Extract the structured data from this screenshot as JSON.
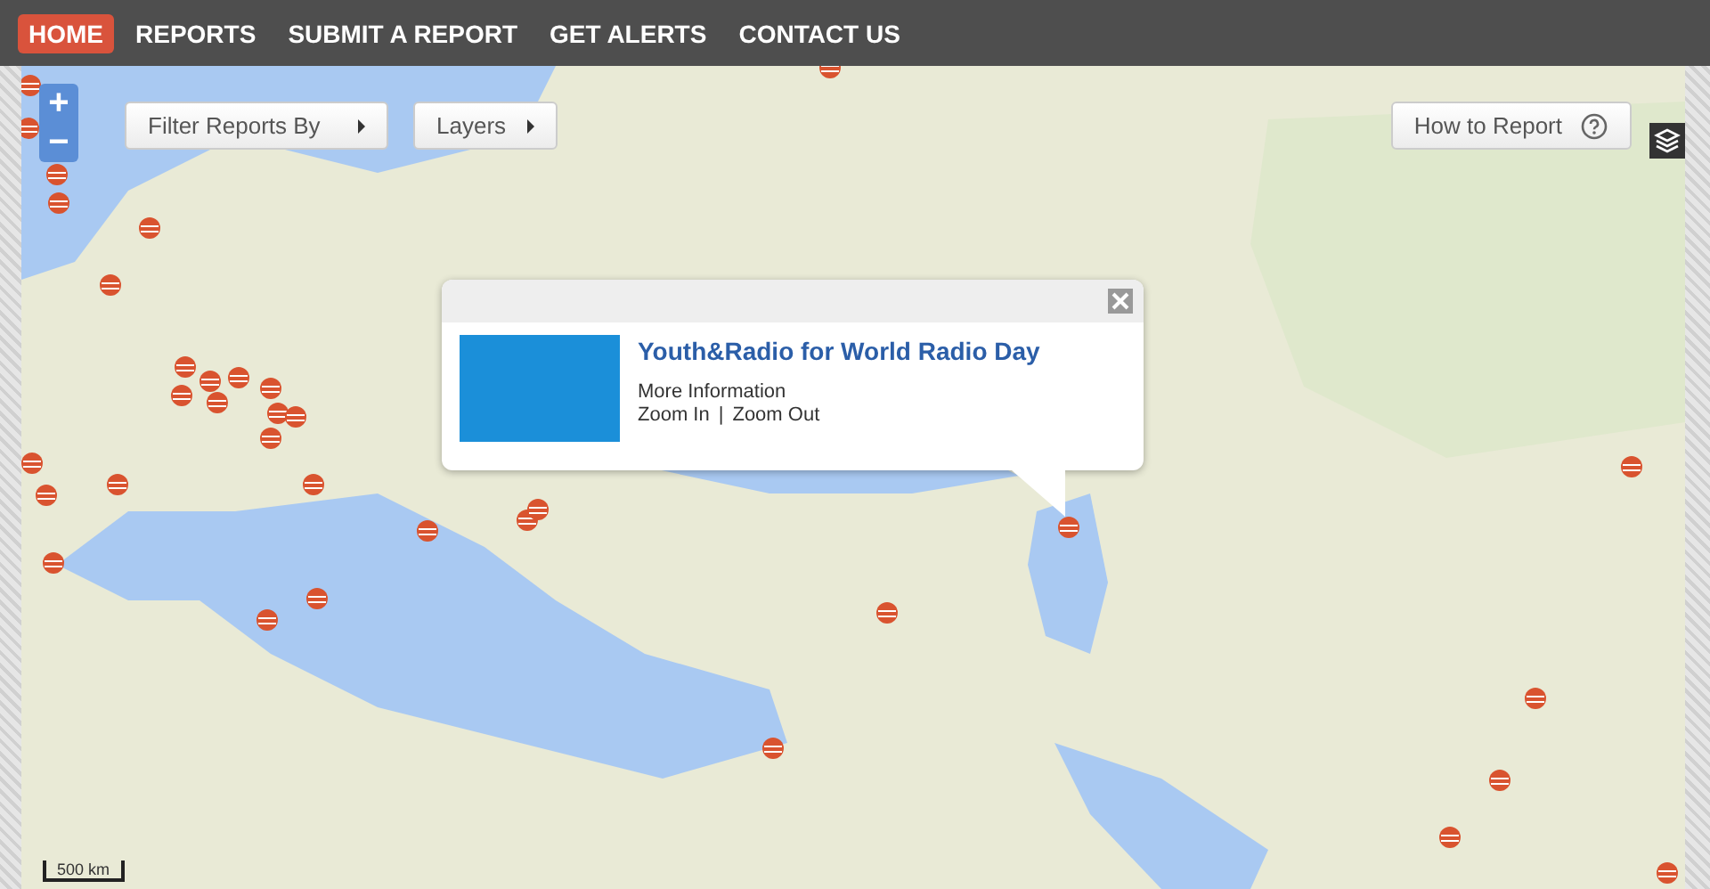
{
  "nav": [
    {
      "label": "HOME",
      "selected": true
    },
    {
      "label": "REPORTS",
      "selected": false
    },
    {
      "label": "SUBMIT A REPORT",
      "selected": false
    },
    {
      "label": "GET ALERTS",
      "selected": false
    },
    {
      "label": "CONTACT US",
      "selected": false
    }
  ],
  "map_controls": {
    "zoom_in": "+",
    "zoom_out": "−",
    "menus": [
      "Filter Reports By",
      "Layers"
    ],
    "help_button": "How to Report"
  },
  "popup": {
    "title": "Youth&Radio for World Radio Day",
    "links": [
      "More Information",
      "Zoom In",
      "Zoom Out"
    ],
    "separator": "|"
  },
  "scale_bar": "500 km"
}
